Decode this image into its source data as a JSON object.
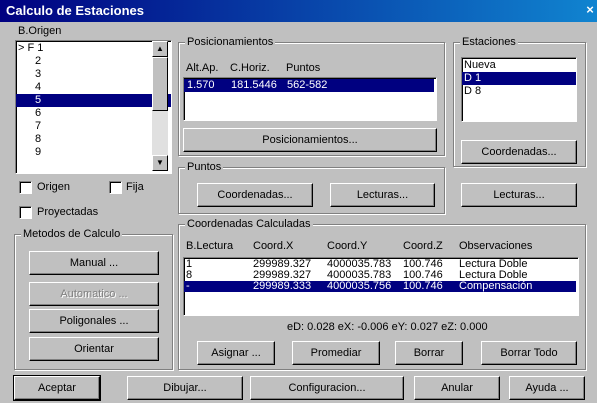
{
  "window": {
    "title": "Calculo de Estaciones",
    "close": "×"
  },
  "b_origen": {
    "label": "B.Origen",
    "items": [
      "> F  1",
      "2",
      "3",
      "4",
      "5",
      "6",
      "7",
      "8",
      "9"
    ],
    "selected_index": 4
  },
  "checkboxes": {
    "origen": "Origen",
    "fija": "Fija",
    "proyectadas": "Proyectadas"
  },
  "metodos": {
    "title": "Metodos de Calculo",
    "manual": "Manual ...",
    "automatico": "Automatico ...",
    "poligonales": "Poligonales ...",
    "orientar": "Orientar"
  },
  "posicionamientos": {
    "title": "Posicionamientos",
    "headers": [
      "Alt.Ap.",
      "C.Horiz.",
      "Puntos"
    ],
    "rows": [
      [
        "1.570",
        "181.5446",
        "562-582"
      ]
    ],
    "button": "Posicionamientos..."
  },
  "estaciones": {
    "title": "Estaciones",
    "items": [
      "Nueva",
      "D 1",
      "D 8"
    ],
    "selected_index": 1,
    "coord_button": "Coordenadas...",
    "lecturas_button": "Lecturas..."
  },
  "puntos": {
    "title": "Puntos",
    "coord_button": "Coordenadas...",
    "lecturas_button": "Lecturas..."
  },
  "coordenadas": {
    "title": "Coordenadas Calculadas",
    "headers": [
      "B.Lectura",
      "Coord.X",
      "Coord.Y",
      "Coord.Z",
      "Observaciones"
    ],
    "rows": [
      [
        "1",
        "299989.327",
        "4000035.783",
        "100.746",
        "Lectura Doble"
      ],
      [
        "8",
        "299989.327",
        "4000035.783",
        "100.746",
        "Lectura Doble"
      ],
      [
        "-",
        "299989.333",
        "4000035.756",
        "100.746",
        "Compensación"
      ]
    ],
    "selected_index": 2,
    "errors": "eD: 0.028  eX: -0.006  eY: 0.027  eZ: 0.000",
    "asignar": "Asignar ...",
    "promediar": "Promediar",
    "borrar": "Borrar",
    "borrar_todo": "Borrar Todo"
  },
  "footer": {
    "aceptar": "Aceptar",
    "dibujar": "Dibujar...",
    "configuracion": "Configuracion...",
    "anular": "Anular",
    "ayuda": "Ayuda ..."
  },
  "colors": {
    "title_bar": "#000080",
    "selection": "#000080",
    "face": "#c0c0c0"
  }
}
